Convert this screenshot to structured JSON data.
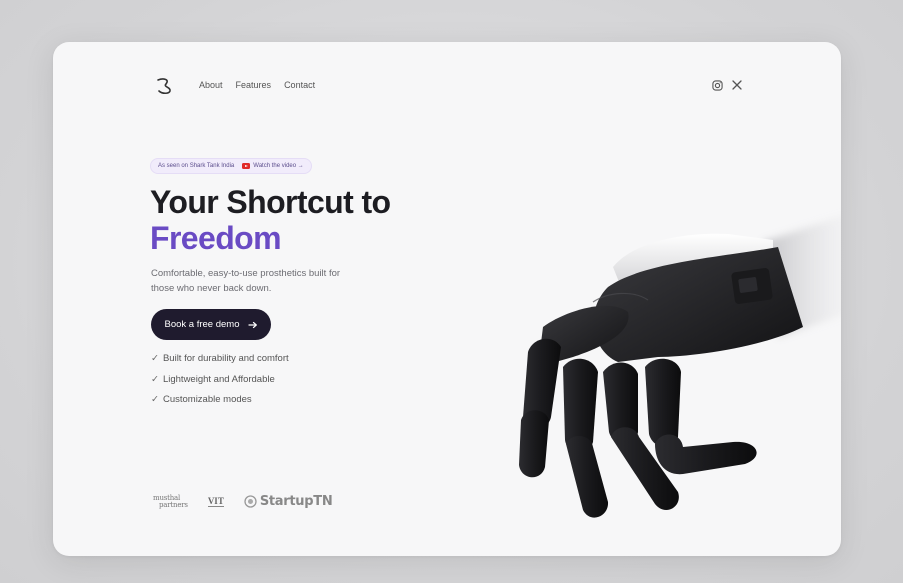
{
  "nav": {
    "links": [
      "About",
      "Features",
      "Contact"
    ],
    "social": [
      "instagram-icon",
      "x-icon"
    ]
  },
  "badge": {
    "text": "As seen on Shark Tank India",
    "video_label": "Watch the video →"
  },
  "hero": {
    "title_line1": "Your Shortcut to",
    "title_line2": "Freedom",
    "subtitle": "Comfortable, easy-to-use prosthetics built for those who never back down.",
    "cta_label": "Book a free demo",
    "features": [
      "Built for durability and comfort",
      "Lightweight and Affordable",
      "Customizable modes"
    ]
  },
  "partners": {
    "p1_line1": "musthal",
    "p1_line2": "partners",
    "p2": "VIT",
    "p3": "StartupTN"
  },
  "colors": {
    "accent": "#6a4bc4",
    "cta_bg": "#1f1b2e",
    "heading": "#1d1d22"
  }
}
